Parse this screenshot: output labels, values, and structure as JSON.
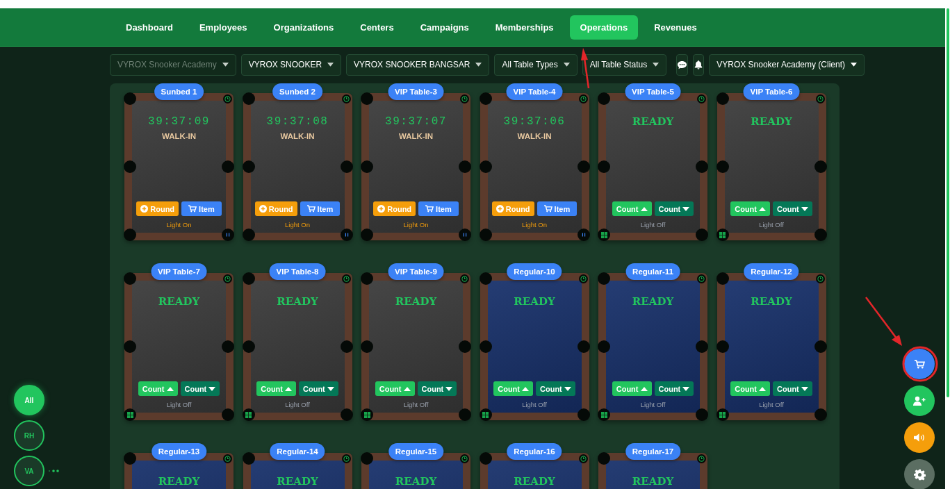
{
  "nav": [
    {
      "label": "Dashboard",
      "selected": false
    },
    {
      "label": "Employees",
      "selected": false
    },
    {
      "label": "Organizations",
      "selected": false
    },
    {
      "label": "Centers",
      "selected": false
    },
    {
      "label": "Campaigns",
      "selected": false
    },
    {
      "label": "Memberships",
      "selected": false
    },
    {
      "label": "Operations",
      "selected": true
    },
    {
      "label": "Revenues",
      "selected": false
    }
  ],
  "filters": [
    {
      "label": "VYROX Snooker Academy",
      "disabled": true
    },
    {
      "label": "VYROX SNOOKER",
      "disabled": false
    },
    {
      "label": "VYROX SNOOKER BANGSAR",
      "disabled": false
    },
    {
      "label": "All Table Types",
      "disabled": false
    },
    {
      "label": "All Table Status",
      "disabled": false
    }
  ],
  "account_menu": {
    "label": "VYROX Snooker Academy (Client)"
  },
  "tables": [
    {
      "name": "Sunbed 1",
      "color": "#3a3a3a",
      "kind": "session",
      "display": "39:37:09",
      "booking": "WALK-IN",
      "actions": [
        {
          "kind": "round",
          "label": "Round"
        },
        {
          "kind": "item",
          "label": "Item"
        }
      ],
      "light": {
        "on": true,
        "label": "Light On"
      }
    },
    {
      "name": "Sunbed 2",
      "color": "#3a3a3a",
      "kind": "session",
      "display": "39:37:08",
      "booking": "WALK-IN",
      "actions": [
        {
          "kind": "round",
          "label": "Round"
        },
        {
          "kind": "item",
          "label": "Item"
        }
      ],
      "light": {
        "on": true,
        "label": "Light On"
      }
    },
    {
      "name": "VIP Table-3",
      "color": "#3a3a3a",
      "kind": "session",
      "display": "39:37:07",
      "booking": "WALK-IN",
      "actions": [
        {
          "kind": "round",
          "label": "Round"
        },
        {
          "kind": "item",
          "label": "Item"
        }
      ],
      "light": {
        "on": true,
        "label": "Light On"
      }
    },
    {
      "name": "VIP Table-4",
      "color": "#3a3a3a",
      "kind": "session",
      "display": "39:37:06",
      "booking": "WALK-IN",
      "actions": [
        {
          "kind": "round",
          "label": "Round"
        },
        {
          "kind": "item",
          "label": "Item"
        }
      ],
      "light": {
        "on": true,
        "label": "Light On"
      }
    },
    {
      "name": "VIP Table-5",
      "color": "#3a3a3a",
      "kind": "idle",
      "display": "READY",
      "actions": [
        {
          "kind": "count_up",
          "label": "Count"
        },
        {
          "kind": "count_down",
          "label": "Count"
        }
      ],
      "light": {
        "on": false,
        "label": "Light Off"
      }
    },
    {
      "name": "VIP Table-6",
      "color": "#3a3a3a",
      "kind": "idle",
      "display": "READY",
      "actions": [
        {
          "kind": "count_up",
          "label": "Count"
        },
        {
          "kind": "count_down",
          "label": "Count"
        }
      ],
      "light": {
        "on": false,
        "label": "Light Off"
      }
    },
    {
      "name": "VIP Table-7",
      "color": "#3a3a3a",
      "kind": "idle",
      "display": "READY",
      "actions": [
        {
          "kind": "count_up",
          "label": "Count"
        },
        {
          "kind": "count_down",
          "label": "Count"
        }
      ],
      "light": {
        "on": false,
        "label": "Light Off"
      }
    },
    {
      "name": "VIP Table-8",
      "color": "#3a3a3a",
      "kind": "idle",
      "display": "READY",
      "actions": [
        {
          "kind": "count_up",
          "label": "Count"
        },
        {
          "kind": "count_down",
          "label": "Count"
        }
      ],
      "light": {
        "on": false,
        "label": "Light Off"
      }
    },
    {
      "name": "VIP Table-9",
      "color": "#3a3a3a",
      "kind": "idle",
      "display": "READY",
      "actions": [
        {
          "kind": "count_up",
          "label": "Count"
        },
        {
          "kind": "count_down",
          "label": "Count"
        }
      ],
      "light": {
        "on": false,
        "label": "Light Off"
      }
    },
    {
      "name": "Regular-10",
      "color": "#17306a",
      "kind": "idle",
      "display": "READY",
      "actions": [
        {
          "kind": "count_up",
          "label": "Count"
        },
        {
          "kind": "count_down",
          "label": "Count"
        }
      ],
      "light": {
        "on": false,
        "label": "Light Off"
      }
    },
    {
      "name": "Regular-11",
      "color": "#17306a",
      "kind": "idle",
      "display": "READY",
      "actions": [
        {
          "kind": "count_up",
          "label": "Count"
        },
        {
          "kind": "count_down",
          "label": "Count"
        }
      ],
      "light": {
        "on": false,
        "label": "Light Off"
      }
    },
    {
      "name": "Regular-12",
      "color": "#17306a",
      "kind": "idle",
      "display": "READY",
      "actions": [
        {
          "kind": "count_up",
          "label": "Count"
        },
        {
          "kind": "count_down",
          "label": "Count"
        }
      ],
      "light": {
        "on": false,
        "label": "Light Off"
      }
    },
    {
      "name": "Regular-13",
      "color": "#17306a",
      "kind": "idle",
      "display": "READY"
    },
    {
      "name": "Regular-14",
      "color": "#17306a",
      "kind": "idle",
      "display": "READY"
    },
    {
      "name": "Regular-15",
      "color": "#17306a",
      "kind": "idle",
      "display": "READY"
    },
    {
      "name": "Regular-16",
      "color": "#17306a",
      "kind": "idle",
      "display": "READY"
    },
    {
      "name": "Regular-17",
      "color": "#17306a",
      "kind": "idle",
      "display": "READY"
    }
  ],
  "user_filters": [
    {
      "label": "All",
      "selected": true
    },
    {
      "label": "RH",
      "selected": false
    },
    {
      "label": "VA",
      "selected": false
    }
  ]
}
